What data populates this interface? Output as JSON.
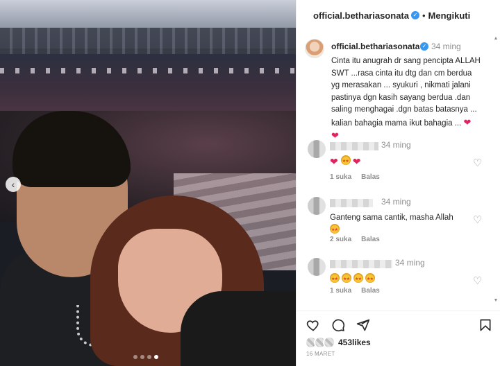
{
  "header": {
    "username": "official.betharia",
    "username_suffix": "sonata",
    "follow_label": "Mengikuti"
  },
  "caption": {
    "username": "official.betharia",
    "username_suffix": "sonata",
    "time": "34 ming",
    "text": "Cinta itu anugrah dr sang pencipta ALLAH SWT ...rasa cinta itu dtg dan cm berdua yg merasakan ... syukuri , nikmati jalani pastinya dgn kasih sayang berdua .dan saling menghagai .dgn batas batasnya ... kalian bahagia mama ikut bahagia ..."
  },
  "comments": [
    {
      "time": "34 ming",
      "emoji_names": [
        "heart",
        "star-struck",
        "heart"
      ],
      "likes": "1 suka",
      "reply": "Balas"
    },
    {
      "time": "34 ming",
      "text": "Ganteng sama cantik, masha Allah",
      "emoji_names": [
        "star-struck"
      ],
      "likes": "2 suka",
      "reply": "Balas"
    },
    {
      "time": "34 ming",
      "emoji_names": [
        "star-struck",
        "star-struck",
        "star-struck",
        "star-struck"
      ],
      "likes": "1 suka",
      "reply": "Balas"
    }
  ],
  "footer": {
    "likes": "453likes",
    "date": "16 MARET"
  },
  "carousel": {
    "prev_glyph": "‹",
    "slide_count": 4,
    "current_slide": 4
  },
  "colors": {
    "verified": "#3897f0",
    "heart": "#e0245e",
    "muted": "#8e8e8e"
  },
  "icons": [
    "verified-badge-icon",
    "heart-icon",
    "comment-icon",
    "share-icon",
    "bookmark-icon",
    "star-struck-emoji-icon",
    "chevron-left-icon"
  ]
}
